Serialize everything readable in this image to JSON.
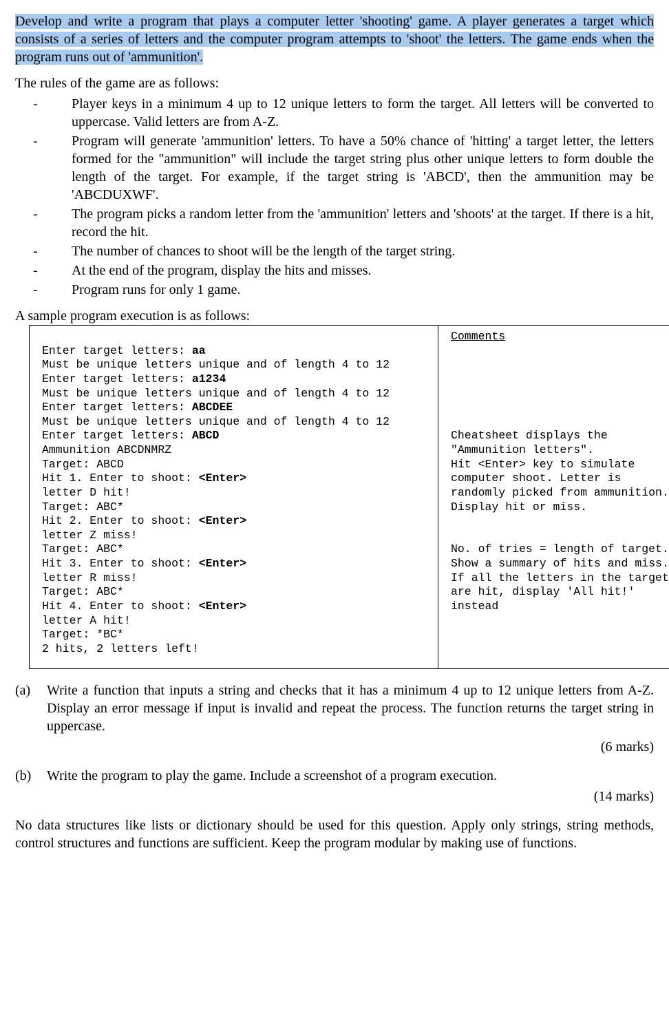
{
  "intro_highlighted": "Develop and write a program that plays a computer letter 'shooting' game. A player generates a target which consists of a series of letters and the computer program attempts to 'shoot' the letters. The game ends when the program runs out of 'ammunition'.",
  "rules_intro": "The rules of the game are as follows:",
  "rules": [
    "Player keys in a minimum 4 up to 12 unique letters to form the target. All letters will be converted to uppercase. Valid letters are from A-Z.",
    "Program will generate 'ammunition' letters. To have a 50% chance of 'hitting' a target letter, the letters formed for the \"ammunition\" will include the target string plus other unique letters to form double the length of the target. For example, if the target string is 'ABCD', then the ammunition may be 'ABCDUXWF'.",
    "The program picks a random letter from the 'ammunition' letters and 'shoots' at the target. If there is a hit, record the hit.",
    "The number of chances to shoot will be the length of the target string.",
    "At the end of the program, display the hits and misses.",
    "Program runs for only 1 game."
  ],
  "sample_intro": "A sample program execution is as follows:",
  "sample": {
    "s0": "",
    "s1": "Enter target letters: ",
    "b1": "aa",
    "s2": "Must be unique letters unique and of length 4 to 12",
    "s3": "Enter target letters: ",
    "b3": "a1234",
    "s4": "Must be unique letters unique and of length 4 to 12",
    "s5": "Enter target letters: ",
    "b5": "ABCDEE",
    "s6": "Must be unique letters unique and of length 4 to 12",
    "s7": "Enter target letters: ",
    "b7": "ABCD",
    "s8": "Ammunition ABCDNMRZ",
    "s9": "Target: ABCD",
    "s10": "Hit 1. Enter to shoot: ",
    "b10": "<Enter>",
    "s11": "letter D hit!",
    "s12": "Target: ABC*",
    "s13": "Hit 2. Enter to shoot: ",
    "b13": "<Enter>",
    "s14": "letter Z miss!",
    "s15": "Target: ABC*",
    "s16": "Hit 3. Enter to shoot: ",
    "b16": "<Enter>",
    "s17": "letter R miss!",
    "s18": "Target: ABC*",
    "s19": "Hit 4. Enter to shoot: ",
    "b19": "<Enter>",
    "s20": "letter A hit!",
    "s21": "Target: *BC*",
    "s22": "2 hits, 2 letters left!"
  },
  "comments": {
    "header": "Comments",
    "c1": "Cheatsheet displays the \"Ammunition letters\".",
    "c2": "Hit <Enter> key to simulate computer shoot. Letter is randomly picked from ammunition.",
    "c3": "Display hit or miss.",
    "c4": "No. of tries = length of target. Show a summary of hits and miss. If all the letters in the target are hit, display 'All hit!' instead"
  },
  "qa": {
    "label": "(a)",
    "text": "Write a function that inputs a string and checks that it has a minimum 4 up to 12 unique letters from A-Z. Display an error message if input is invalid and repeat the process. The function returns the target string in uppercase.",
    "marks": "(6 marks)"
  },
  "qb": {
    "label": "(b)",
    "text": "Write the program to play the game. Include a screenshot of a program execution.",
    "marks": "(14 marks)"
  },
  "final": "No data structures like lists or dictionary should be used for this question. Apply only strings, string methods, control structures and functions are sufficient. Keep the program modular by making use of functions."
}
